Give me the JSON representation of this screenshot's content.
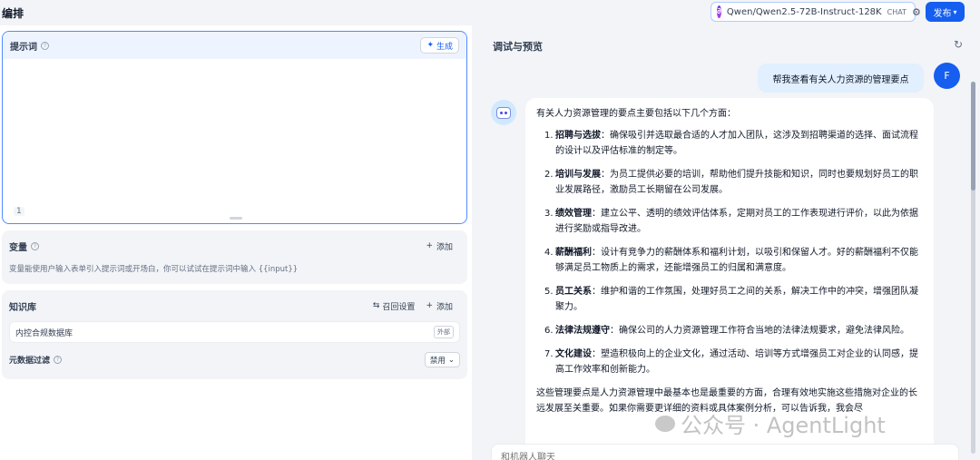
{
  "header": {
    "title": "编排",
    "model": {
      "name": "Qwen/Qwen2.5-72B-Instruct-128K",
      "tag": "CHAT"
    },
    "publish_label": "发布"
  },
  "prompt": {
    "label": "提示词",
    "generate_label": "生成",
    "line_count": "1"
  },
  "variables": {
    "label": "变量",
    "add_label": "添加",
    "hint": "变量能使用户输入表单引入提示词或开场白，你可以试试在提示词中输入 {{input}}"
  },
  "knowledge": {
    "label": "知识库",
    "recall_label": "召回设置",
    "add_label": "添加",
    "item_name": "内控合规数据库",
    "item_badge": "外部",
    "metadata_label": "元数据过滤",
    "metadata_value": "禁用"
  },
  "debug": {
    "title": "调试与预览",
    "user_message": "帮我查看有关人力资源的管理要点",
    "user_initial": "F",
    "bot": {
      "intro": "有关人力资源管理的要点主要包括以下几个方面：",
      "points": [
        {
          "num": "1.",
          "title": "招聘与选拔",
          "text": "：确保吸引并选取最合适的人才加入团队，这涉及到招聘渠道的选择、面试流程的设计以及评估标准的制定等。"
        },
        {
          "num": "2.",
          "title": "培训与发展",
          "text": "：为员工提供必要的培训，帮助他们提升技能和知识，同时也要规划好员工的职业发展路径，激励员工长期留在公司发展。"
        },
        {
          "num": "3.",
          "title": "绩效管理",
          "text": "：建立公平、透明的绩效评估体系，定期对员工的工作表现进行评价，以此为依据进行奖励或指导改进。"
        },
        {
          "num": "4.",
          "title": "薪酬福利",
          "text": "：设计有竞争力的薪酬体系和福利计划，以吸引和保留人才。好的薪酬福利不仅能够满足员工物质上的需求，还能增强员工的归属和满意度。"
        },
        {
          "num": "5.",
          "title": "员工关系",
          "text": "：维护和谐的工作氛围，处理好员工之间的关系，解决工作中的冲突，增强团队凝聚力。"
        },
        {
          "num": "6.",
          "title": "法律法规遵守",
          "text": "：确保公司的人力资源管理工作符合当地的法律法规要求，避免法律风险。"
        },
        {
          "num": "7.",
          "title": "文化建设",
          "text": "：塑造积极向上的企业文化，通过活动、培训等方式增强员工对企业的认同感，提高工作效率和创新能力。"
        }
      ],
      "summary": "这些管理要点是人力资源管理中最基本也是最重要的方面，合理有效地实施这些措施对企业的长远发展至关重要。如果你需要更详细的资料或具体案例分析，可以告诉我，我会尽"
    },
    "input_placeholder": "和机器人聊天"
  },
  "watermark": "公众号 · AgentLight",
  "colors": {
    "accent": "#155eef",
    "user_bubble": "#e1effe"
  }
}
